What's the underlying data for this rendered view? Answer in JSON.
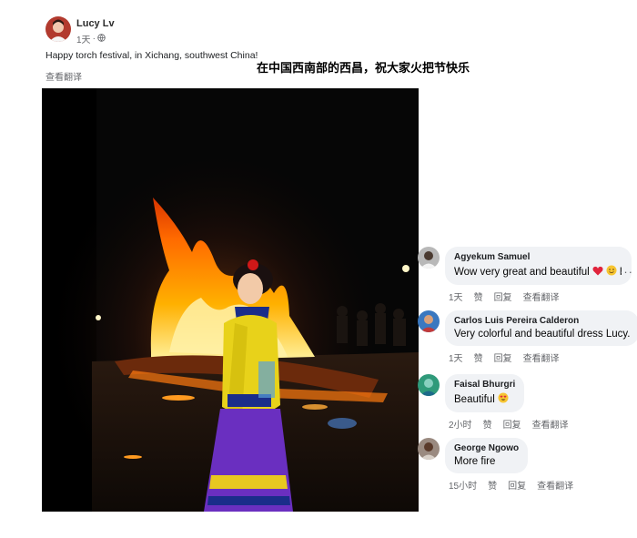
{
  "post": {
    "author": "Lucy Lv",
    "time": "1天",
    "privacy_icon": "globe-icon",
    "text": "Happy torch festival, in Xichang, southwest China!",
    "chinese_caption": "在中国西南部的西昌，祝大家火把节快乐",
    "see_translation": "查看翻译"
  },
  "comments": [
    {
      "name": "Agyekum Samuel",
      "text": "Wow very great and beautiful",
      "emoji": "I",
      "time": "1天",
      "like": "赞",
      "reply": "回复",
      "translate": "查看翻译"
    },
    {
      "name": "Carlos Luis Pereira Calderon",
      "text": "Very colorful and beautiful dress Lucy.",
      "time": "1天",
      "like": "赞",
      "reply": "回复",
      "translate": "查看翻译"
    },
    {
      "name": "Faisal Bhurgri",
      "text": "Beautiful",
      "time": "2小时",
      "like": "赞",
      "reply": "回复",
      "translate": "查看翻译"
    },
    {
      "name": "George Ngowo",
      "text": "More fire",
      "time": "15小时",
      "like": "赞",
      "reply": "回复",
      "translate": "查看翻译"
    }
  ],
  "colors": {
    "link_gray": "#65676b",
    "bubble": "#f0f2f5",
    "dress_yellow": "#e8d21a",
    "skirt_purple": "#6a2fc0",
    "fire": "#ff8a00"
  }
}
